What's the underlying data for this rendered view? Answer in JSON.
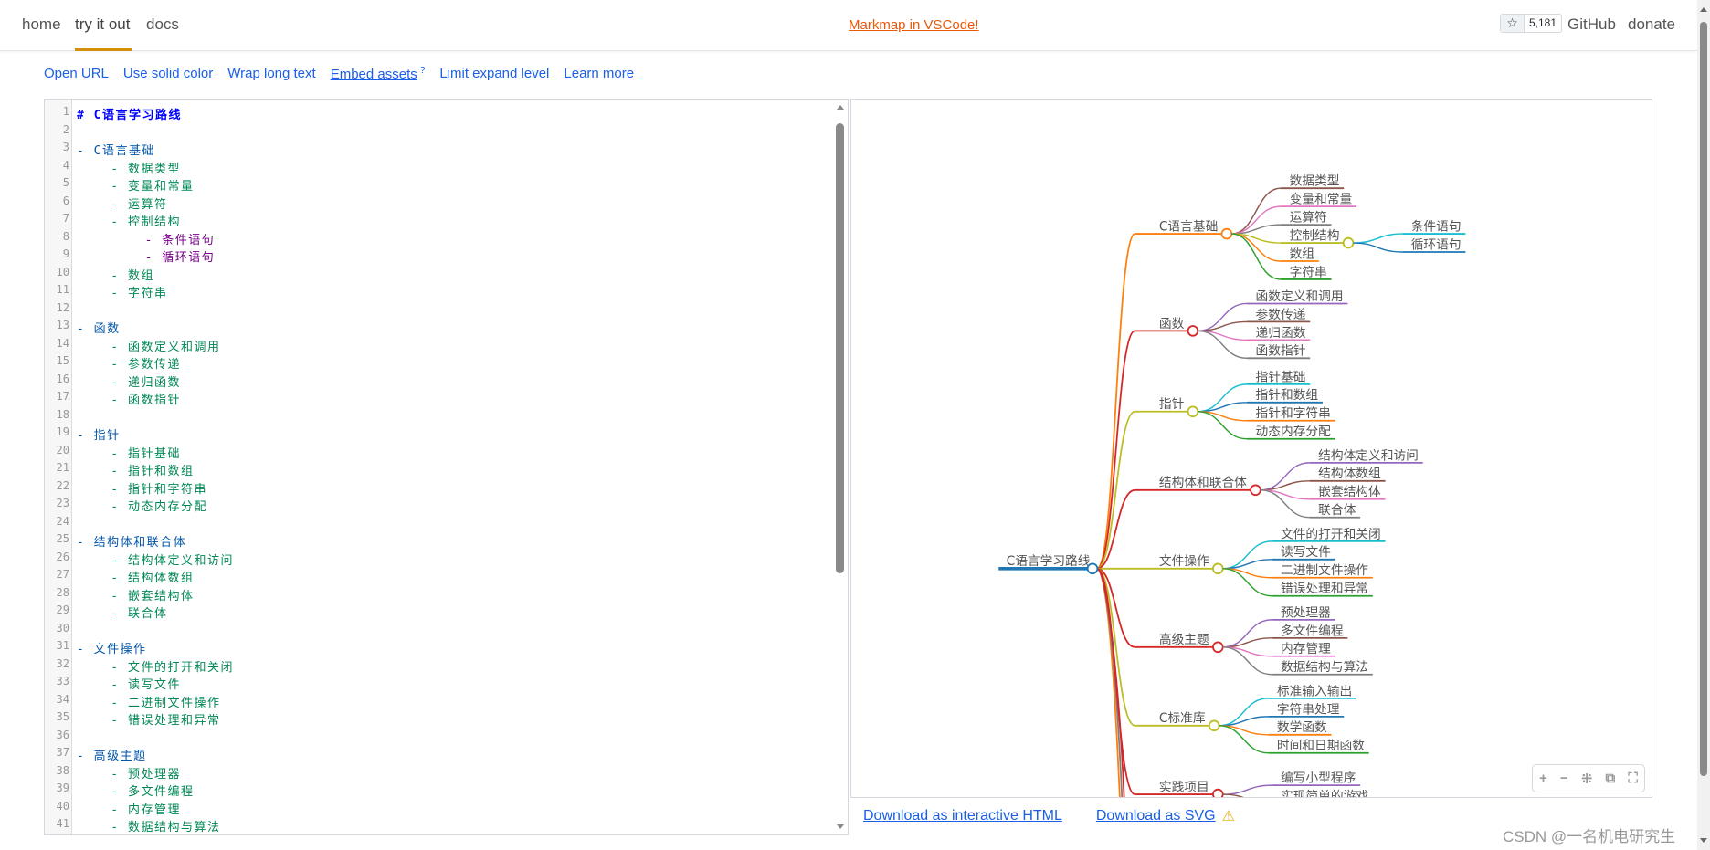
{
  "header": {
    "nav": [
      "home",
      "try it out",
      "docs"
    ],
    "active_tab": "try it out",
    "promo_link": "Markmap in VSCode!",
    "star_icon": "star-icon",
    "star_count": "5,181",
    "github": "GitHub",
    "donate": "donate"
  },
  "toolbar": {
    "open_url": "Open URL",
    "solid_color": "Use solid color",
    "wrap_text": "Wrap long text",
    "embed_assets": "Embed assets",
    "embed_help": "?",
    "limit_expand": "Limit expand level",
    "learn_more": "Learn more"
  },
  "editor": {
    "lines": [
      {
        "n": "1",
        "level": 0,
        "text": "# C语言学习路线"
      },
      {
        "n": "2",
        "level": 1,
        "text": ""
      },
      {
        "n": "3",
        "level": 1,
        "text": "- C语言基础"
      },
      {
        "n": "4",
        "level": 2,
        "text": "    - 数据类型"
      },
      {
        "n": "5",
        "level": 2,
        "text": "    - 变量和常量"
      },
      {
        "n": "6",
        "level": 2,
        "text": "    - 运算符"
      },
      {
        "n": "7",
        "level": 2,
        "text": "    - 控制结构"
      },
      {
        "n": "8",
        "level": 3,
        "text": "        - 条件语句"
      },
      {
        "n": "9",
        "level": 3,
        "text": "        - 循环语句"
      },
      {
        "n": "10",
        "level": 2,
        "text": "    - 数组"
      },
      {
        "n": "11",
        "level": 2,
        "text": "    - 字符串"
      },
      {
        "n": "12",
        "level": 1,
        "text": ""
      },
      {
        "n": "13",
        "level": 1,
        "text": "- 函数"
      },
      {
        "n": "14",
        "level": 2,
        "text": "    - 函数定义和调用"
      },
      {
        "n": "15",
        "level": 2,
        "text": "    - 参数传递"
      },
      {
        "n": "16",
        "level": 2,
        "text": "    - 递归函数"
      },
      {
        "n": "17",
        "level": 2,
        "text": "    - 函数指针"
      },
      {
        "n": "18",
        "level": 1,
        "text": ""
      },
      {
        "n": "19",
        "level": 1,
        "text": "- 指针"
      },
      {
        "n": "20",
        "level": 2,
        "text": "    - 指针基础"
      },
      {
        "n": "21",
        "level": 2,
        "text": "    - 指针和数组"
      },
      {
        "n": "22",
        "level": 2,
        "text": "    - 指针和字符串"
      },
      {
        "n": "23",
        "level": 2,
        "text": "    - 动态内存分配"
      },
      {
        "n": "24",
        "level": 1,
        "text": ""
      },
      {
        "n": "25",
        "level": 1,
        "text": "- 结构体和联合体"
      },
      {
        "n": "26",
        "level": 2,
        "text": "    - 结构体定义和访问"
      },
      {
        "n": "27",
        "level": 2,
        "text": "    - 结构体数组"
      },
      {
        "n": "28",
        "level": 2,
        "text": "    - 嵌套结构体"
      },
      {
        "n": "29",
        "level": 2,
        "text": "    - 联合体"
      },
      {
        "n": "30",
        "level": 1,
        "text": ""
      },
      {
        "n": "31",
        "level": 1,
        "text": "- 文件操作"
      },
      {
        "n": "32",
        "level": 2,
        "text": "    - 文件的打开和关闭"
      },
      {
        "n": "33",
        "level": 2,
        "text": "    - 读写文件"
      },
      {
        "n": "34",
        "level": 2,
        "text": "    - 二进制文件操作"
      },
      {
        "n": "35",
        "level": 2,
        "text": "    - 错误处理和异常"
      },
      {
        "n": "36",
        "level": 1,
        "text": ""
      },
      {
        "n": "37",
        "level": 1,
        "text": "- 高级主题"
      },
      {
        "n": "38",
        "level": 2,
        "text": "    - 预处理器"
      },
      {
        "n": "39",
        "level": 2,
        "text": "    - 多文件编程"
      },
      {
        "n": "40",
        "level": 2,
        "text": "    - 内存管理"
      },
      {
        "n": "41",
        "level": 2,
        "text": "    - 数据结构与算法"
      }
    ]
  },
  "mindmap": {
    "root": {
      "label": "C语言学习路线",
      "color": "#1f77b4"
    },
    "branches": [
      {
        "label": "C语言基础",
        "color": "#ff7f0e",
        "children": [
          {
            "label": "数据类型",
            "color": "#8c564b"
          },
          {
            "label": "变量和常量",
            "color": "#e377c2"
          },
          {
            "label": "运算符",
            "color": "#7f7f7f"
          },
          {
            "label": "控制结构",
            "color": "#bcbd22",
            "children": [
              {
                "label": "条件语句",
                "color": "#17becf"
              },
              {
                "label": "循环语句",
                "color": "#1f77b4"
              }
            ]
          },
          {
            "label": "数组",
            "color": "#ff7f0e"
          },
          {
            "label": "字符串",
            "color": "#2ca02c"
          }
        ]
      },
      {
        "label": "函数",
        "color": "#d62728",
        "children": [
          {
            "label": "函数定义和调用",
            "color": "#9467bd"
          },
          {
            "label": "参数传递",
            "color": "#8c564b"
          },
          {
            "label": "递归函数",
            "color": "#e377c2"
          },
          {
            "label": "函数指针",
            "color": "#7f7f7f"
          }
        ]
      },
      {
        "label": "指针",
        "color": "#bcbd22",
        "children": [
          {
            "label": "指针基础",
            "color": "#17becf"
          },
          {
            "label": "指针和数组",
            "color": "#1f77b4"
          },
          {
            "label": "指针和字符串",
            "color": "#ff7f0e"
          },
          {
            "label": "动态内存分配",
            "color": "#2ca02c"
          }
        ]
      },
      {
        "label": "结构体和联合体",
        "color": "#d62728",
        "children": [
          {
            "label": "结构体定义和访问",
            "color": "#9467bd"
          },
          {
            "label": "结构体数组",
            "color": "#8c564b"
          },
          {
            "label": "嵌套结构体",
            "color": "#e377c2"
          },
          {
            "label": "联合体",
            "color": "#7f7f7f"
          }
        ]
      },
      {
        "label": "文件操作",
        "color": "#bcbd22",
        "children": [
          {
            "label": "文件的打开和关闭",
            "color": "#17becf"
          },
          {
            "label": "读写文件",
            "color": "#1f77b4"
          },
          {
            "label": "二进制文件操作",
            "color": "#ff7f0e"
          },
          {
            "label": "错误处理和异常",
            "color": "#2ca02c"
          }
        ]
      },
      {
        "label": "高级主题",
        "color": "#d62728",
        "children": [
          {
            "label": "预处理器",
            "color": "#9467bd"
          },
          {
            "label": "多文件编程",
            "color": "#8c564b"
          },
          {
            "label": "内存管理",
            "color": "#e377c2"
          },
          {
            "label": "数据结构与算法",
            "color": "#7f7f7f"
          }
        ]
      },
      {
        "label": "C标准库",
        "color": "#bcbd22",
        "children": [
          {
            "label": "标准输入输出",
            "color": "#17becf"
          },
          {
            "label": "字符串处理",
            "color": "#1f77b4"
          },
          {
            "label": "数学函数",
            "color": "#ff7f0e"
          },
          {
            "label": "时间和日期函数",
            "color": "#2ca02c"
          }
        ]
      },
      {
        "label": "实践项目",
        "color": "#d62728",
        "children": [
          {
            "label": "编写小型程序",
            "color": "#9467bd"
          },
          {
            "label": "实现简单的游戏",
            "color": "#8c564b"
          }
        ]
      }
    ],
    "offscreen_branch_colors": [
      "#ff7f0e",
      "#7f7f7f",
      "#d62728"
    ],
    "controls": [
      "zoom-in",
      "zoom-out",
      "fit",
      "toggle-recursively",
      "fullscreen"
    ],
    "control_glyphs": [
      "+",
      "−",
      "⁜",
      "⧉",
      "⛶"
    ]
  },
  "downloads": {
    "html": "Download as interactive HTML",
    "svg": "Download as SVG",
    "warning": "⚠"
  },
  "watermark": "CSDN @一名机电研究生"
}
